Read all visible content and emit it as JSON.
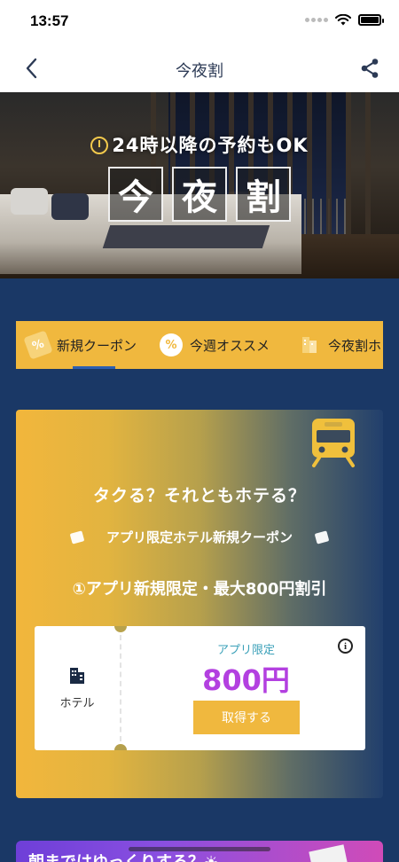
{
  "status_bar": {
    "time": "13:57"
  },
  "nav": {
    "title": "今夜割"
  },
  "hero": {
    "subtitle": "24時以降の予約もOK",
    "title_chars": [
      "今",
      "夜",
      "割"
    ]
  },
  "tabs": [
    {
      "label": "新規クーポン",
      "icon": "coupon-tag-icon",
      "icon_text": "%",
      "selected": true
    },
    {
      "label": "今週オススメ",
      "icon": "percent-badge-icon",
      "icon_text": "%",
      "selected": false
    },
    {
      "label": "今夜割ホ",
      "icon": "hotel-building-icon",
      "icon_text": "",
      "selected": false
    }
  ],
  "coupon_card": {
    "heading": "タクる？それともホテる？",
    "subtitle": "アプリ限定ホテル新規クーポン",
    "description": "①アプリ新規限定・最大800円割引",
    "ticket": {
      "category": "ホテル",
      "limited_label": "アプリ限定",
      "price": "800円",
      "button_label": "取得する"
    }
  },
  "next_banner": {
    "text": "朝まではゆっくりする？☀"
  },
  "colors": {
    "accent": "#f0b83e",
    "navy": "#1a3866",
    "price": "#b340e0",
    "tab_underline": "#2d5fb0"
  }
}
